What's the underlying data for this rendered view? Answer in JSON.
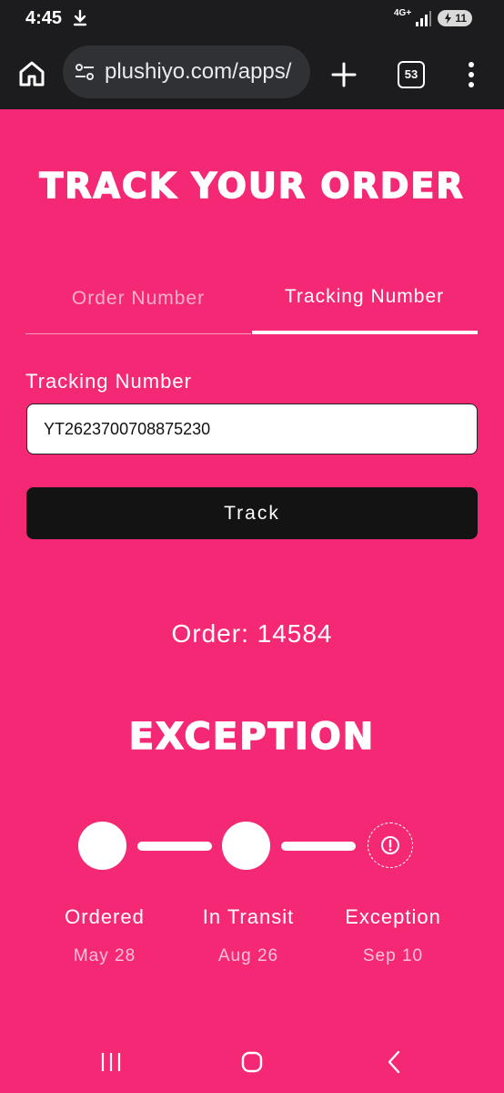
{
  "status_bar": {
    "time": "4:45",
    "network": "4G+",
    "battery": "11"
  },
  "browser": {
    "url": "plushiyo.com/apps/",
    "tab_count": "53"
  },
  "page": {
    "title": "Track your order",
    "tabs": [
      {
        "label": "Order Number",
        "active": false
      },
      {
        "label": "Tracking Number",
        "active": true
      }
    ],
    "field_label": "Tracking Number",
    "tracking_value": "YT2623700708875230",
    "track_button": "Track",
    "order_line": "Order: 14584",
    "status_heading": "Exception",
    "steps": [
      {
        "label": "Ordered",
        "date": "May 28"
      },
      {
        "label": "In Transit",
        "date": "Aug 26"
      },
      {
        "label": "Exception",
        "date": "Sep 10"
      }
    ]
  },
  "colors": {
    "background": "#f52876",
    "button": "#131313",
    "browser_chrome": "#1c1c1e"
  }
}
